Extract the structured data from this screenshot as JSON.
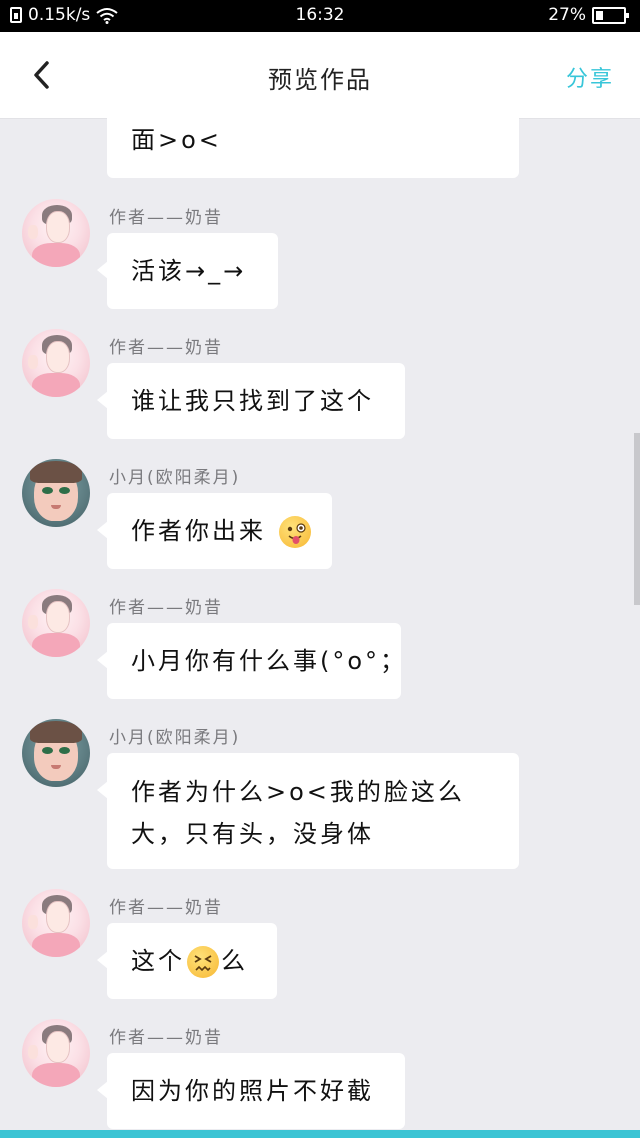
{
  "status_bar": {
    "speed": "0.15k/s",
    "time": "16:32",
    "battery": "27%"
  },
  "header": {
    "title": "预览作品",
    "share": "分享"
  },
  "messages": [
    {
      "text": "面>o<"
    },
    {
      "name": "作者——奶昔",
      "text": "活该→_→"
    },
    {
      "name": "作者——奶昔",
      "text": "谁让我只找到了这个"
    },
    {
      "name": "小月(欧阳柔月)",
      "text": "作者你出来"
    },
    {
      "name": "作者——奶昔",
      "text": "小月你有什么事(°o°；"
    },
    {
      "name": "小月(欧阳柔月)",
      "line1": "作者为什么>o<我的脸这么",
      "line2": "大，只有头，没身体"
    },
    {
      "name": "作者——奶昔",
      "text_a": "这个",
      "text_b": "么"
    },
    {
      "name": "作者——奶昔",
      "text": "因为你的照片不好截"
    }
  ],
  "colors": {
    "accent": "#38c6d9",
    "background": "#ececf0",
    "bubble": "#ffffff",
    "name_text": "#7a7a7e"
  },
  "icons": {
    "back": "chevron-left-icon",
    "wifi": "wifi-icon",
    "battery": "battery-icon",
    "emoji_tongue": "winking-tongue-emoji",
    "emoji_confounded": "confounded-face-emoji"
  }
}
